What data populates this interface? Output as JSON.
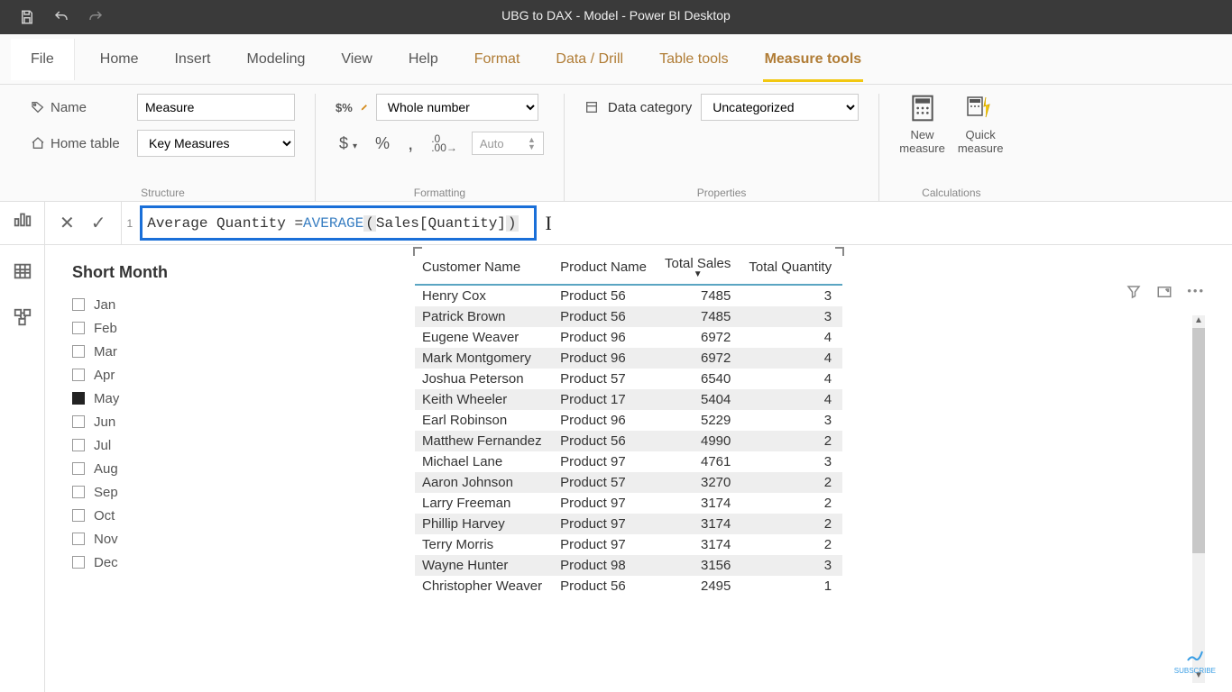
{
  "titlebar": {
    "title": "UBG to DAX - Model - Power BI Desktop"
  },
  "menu": {
    "file": "File",
    "items": [
      "Home",
      "Insert",
      "Modeling",
      "View",
      "Help",
      "Format",
      "Data / Drill",
      "Table tools",
      "Measure tools"
    ],
    "brownStart": 5,
    "activeIndex": 8
  },
  "ribbon": {
    "structure": {
      "nameLabel": "Name",
      "nameValue": "Measure",
      "homeTableLabel": "Home table",
      "homeTableValue": "Key Measures",
      "group": "Structure"
    },
    "formatting": {
      "typeValue": "Whole number",
      "autoLabel": "Auto",
      "group": "Formatting"
    },
    "properties": {
      "dataCatLabel": "Data category",
      "dataCatValue": "Uncategorized",
      "group": "Properties"
    },
    "calculations": {
      "newMeasure1": "New",
      "newMeasure2": "measure",
      "quickMeasure1": "Quick",
      "quickMeasure2": "measure",
      "group": "Calculations"
    }
  },
  "formula": {
    "lineNum": "1",
    "text1": "Average Quantity = ",
    "fn": "AVERAGE",
    "lp": "(",
    "arg": " Sales[Quantity] ",
    "rp": ")"
  },
  "slicer": {
    "title": "Short Month",
    "items": [
      {
        "label": "Jan",
        "checked": false
      },
      {
        "label": "Feb",
        "checked": false
      },
      {
        "label": "Mar",
        "checked": false
      },
      {
        "label": "Apr",
        "checked": false
      },
      {
        "label": "May",
        "checked": true
      },
      {
        "label": "Jun",
        "checked": false
      },
      {
        "label": "Jul",
        "checked": false
      },
      {
        "label": "Aug",
        "checked": false
      },
      {
        "label": "Sep",
        "checked": false
      },
      {
        "label": "Oct",
        "checked": false
      },
      {
        "label": "Nov",
        "checked": false
      },
      {
        "label": "Dec",
        "checked": false
      }
    ]
  },
  "table": {
    "headers": [
      "Customer Name",
      "Product Name",
      "Total Sales",
      "Total Quantity"
    ],
    "sortCol": 2,
    "rows": [
      [
        "Henry Cox",
        "Product 56",
        "7485",
        "3"
      ],
      [
        "Patrick Brown",
        "Product 56",
        "7485",
        "3"
      ],
      [
        "Eugene Weaver",
        "Product 96",
        "6972",
        "4"
      ],
      [
        "Mark Montgomery",
        "Product 96",
        "6972",
        "4"
      ],
      [
        "Joshua Peterson",
        "Product 57",
        "6540",
        "4"
      ],
      [
        "Keith Wheeler",
        "Product 17",
        "5404",
        "4"
      ],
      [
        "Earl Robinson",
        "Product 96",
        "5229",
        "3"
      ],
      [
        "Matthew Fernandez",
        "Product 56",
        "4990",
        "2"
      ],
      [
        "Michael Lane",
        "Product 97",
        "4761",
        "3"
      ],
      [
        "Aaron Johnson",
        "Product 57",
        "3270",
        "2"
      ],
      [
        "Larry Freeman",
        "Product 97",
        "3174",
        "2"
      ],
      [
        "Phillip Harvey",
        "Product 97",
        "3174",
        "2"
      ],
      [
        "Terry Morris",
        "Product 97",
        "3174",
        "2"
      ],
      [
        "Wayne Hunter",
        "Product 98",
        "3156",
        "3"
      ],
      [
        "Christopher Weaver",
        "Product 56",
        "2495",
        "1"
      ]
    ]
  },
  "subscribe": "SUBSCRIBE"
}
